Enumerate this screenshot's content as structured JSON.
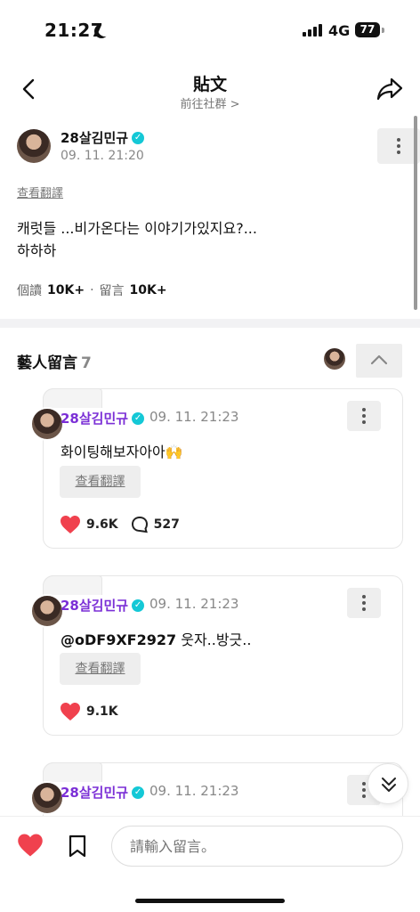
{
  "status_bar": {
    "time": "21:27",
    "network": "4G",
    "battery": "77"
  },
  "header": {
    "title": "貼文",
    "subtitle": "前往社群 >"
  },
  "post": {
    "author": "28살김민규",
    "time": "09. 11. 21:20",
    "translate": "查看翻譯",
    "body": "캐럿들 ...비가온다는 이야기가있지요?...\n하하하",
    "views_label": "個讀",
    "views": "10K+",
    "comments_label": "留言",
    "comments": "10K+"
  },
  "artist_comments": {
    "title": "藝人留言",
    "count": "7"
  },
  "comments": [
    {
      "author": "28살김민규",
      "time": "09. 11. 21:23",
      "text": "화이팅해보자아아🙌",
      "translate": "查看翻譯",
      "likes": "9.6K",
      "replies": "527"
    },
    {
      "author": "28살김민규",
      "time": "09. 11. 21:23",
      "mention": "@oDF9XF2927",
      "text": " 웃자..방긋..",
      "translate": "查看翻譯",
      "likes": "9.1K"
    },
    {
      "author": "28살김민규",
      "time": "09. 11. 21:23"
    }
  ],
  "bottom": {
    "placeholder": "請輸入留言。"
  },
  "colors": {
    "accent_purple": "#7b2fd6",
    "verified": "#14c8d6",
    "heart": "#f0414e"
  },
  "icons": [
    "back-icon",
    "share-icon",
    "more-icon",
    "verified-icon",
    "chevron-up-icon",
    "chevron-down-icon",
    "heart-icon",
    "comment-icon",
    "bookmark-icon",
    "moon-icon",
    "signal-icon",
    "battery-icon"
  ]
}
